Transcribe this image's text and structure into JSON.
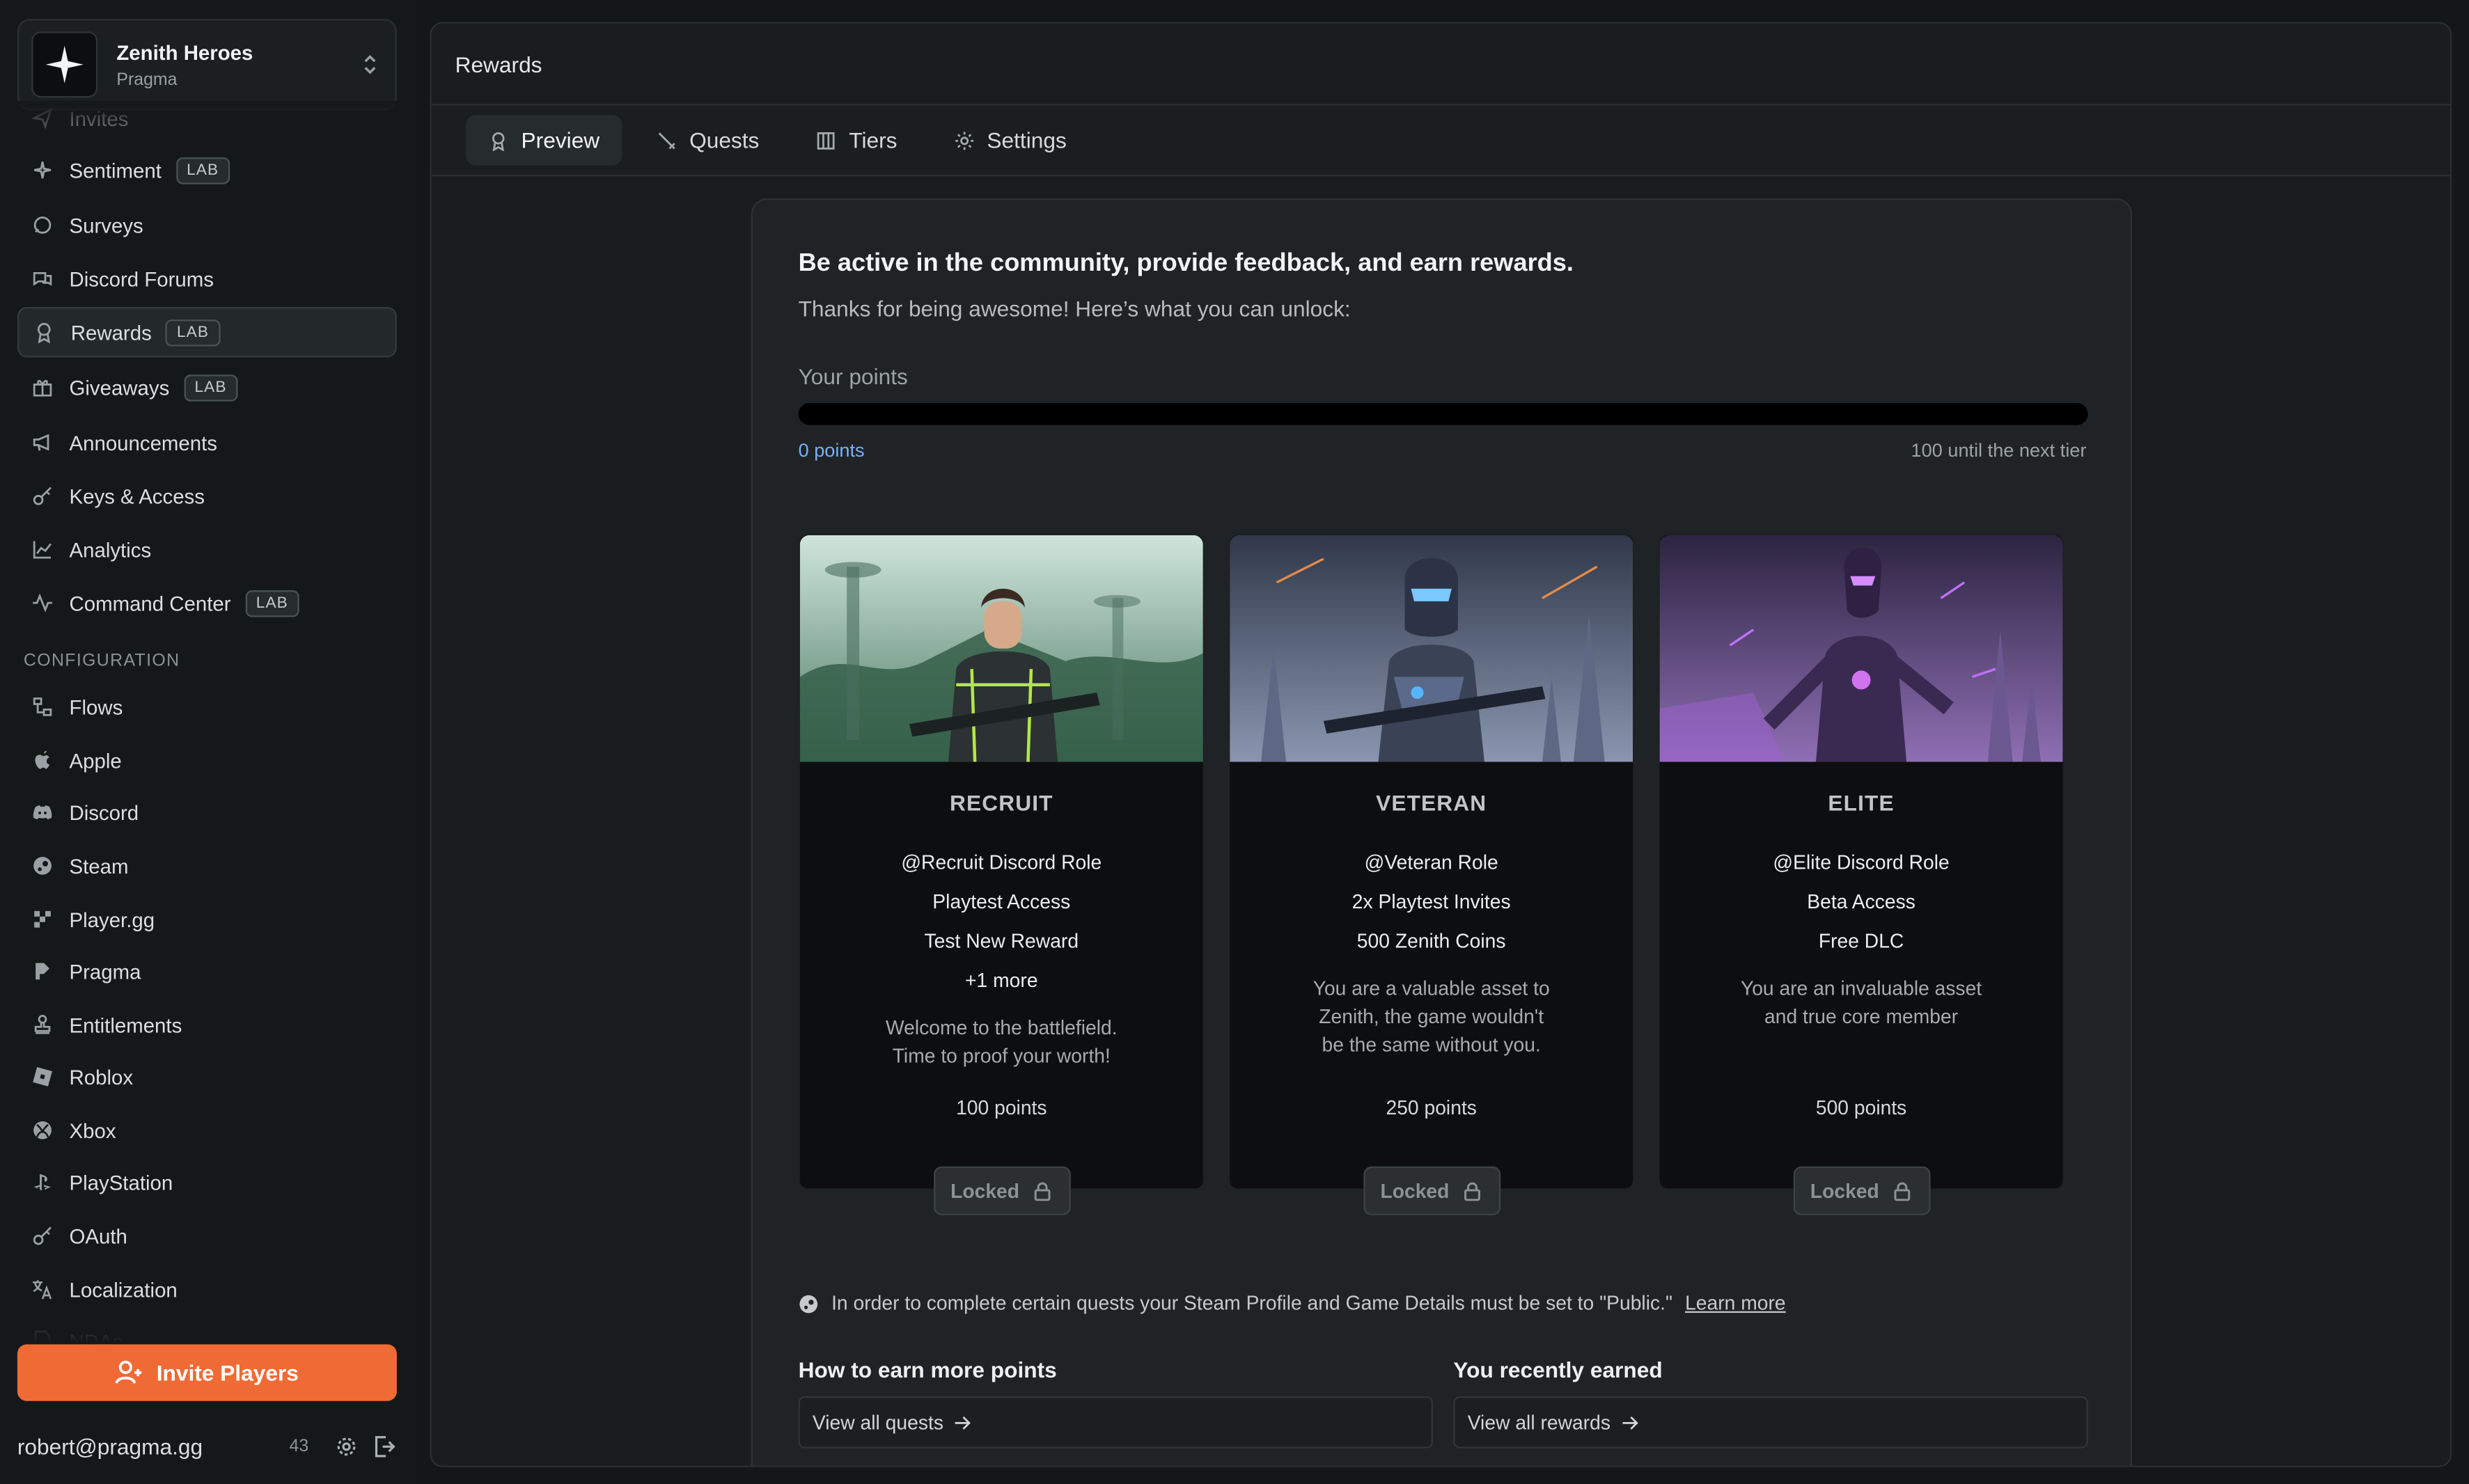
{
  "org": {
    "name": "Zenith Heroes",
    "sub": "Pragma"
  },
  "nav": {
    "items": [
      {
        "label": "Invites",
        "icon": "send-icon",
        "lab": ""
      },
      {
        "label": "Sentiment",
        "icon": "sparkle-icon",
        "lab": "LAB"
      },
      {
        "label": "Surveys",
        "icon": "chat-icon",
        "lab": ""
      },
      {
        "label": "Discord Forums",
        "icon": "forum-icon",
        "lab": ""
      },
      {
        "label": "Rewards",
        "icon": "award-icon",
        "lab": "LAB",
        "active": true
      },
      {
        "label": "Giveaways",
        "icon": "gift-icon",
        "lab": "LAB"
      },
      {
        "label": "Announcements",
        "icon": "megaphone-icon",
        "lab": ""
      },
      {
        "label": "Keys & Access",
        "icon": "key-icon",
        "lab": ""
      },
      {
        "label": "Analytics",
        "icon": "chart-icon",
        "lab": ""
      },
      {
        "label": "Command Center",
        "icon": "pulse-icon",
        "lab": "LAB"
      }
    ],
    "config_label": "CONFIGURATION",
    "config_items": [
      {
        "label": "Flows",
        "icon": "flow-icon"
      },
      {
        "label": "Apple",
        "icon": "apple-icon"
      },
      {
        "label": "Discord",
        "icon": "discord-icon"
      },
      {
        "label": "Steam",
        "icon": "steam-icon"
      },
      {
        "label": "Player.gg",
        "icon": "playergg-icon"
      },
      {
        "label": "Pragma",
        "icon": "pragma-icon"
      },
      {
        "label": "Entitlements",
        "icon": "stamp-icon"
      },
      {
        "label": "Roblox",
        "icon": "roblox-icon"
      },
      {
        "label": "Xbox",
        "icon": "xbox-icon"
      },
      {
        "label": "PlayStation",
        "icon": "playstation-icon"
      },
      {
        "label": "OAuth",
        "icon": "key-icon"
      },
      {
        "label": "Localization",
        "icon": "translate-icon"
      },
      {
        "label": "NDAs",
        "icon": "document-icon"
      }
    ]
  },
  "invite_label": "Invite Players",
  "user": {
    "email": "robert@pragma.gg",
    "count": "43"
  },
  "header": {
    "title": "Rewards"
  },
  "tabs": [
    {
      "label": "Preview",
      "icon": "award-icon",
      "active": true
    },
    {
      "label": "Quests",
      "icon": "sword-icon"
    },
    {
      "label": "Tiers",
      "icon": "columns-icon"
    },
    {
      "label": "Settings",
      "icon": "gear-icon"
    }
  ],
  "panel": {
    "headline": "Be active in the community, provide feedback, and earn rewards.",
    "subline": "Thanks for being awesome! Here’s what you can unlock:",
    "your_points_label": "Your points",
    "progress": 0,
    "points_text": "0 points",
    "next_text": "100 until the next tier",
    "tiers": [
      {
        "name": "RECRUIT",
        "perks": [
          "@Recruit Discord Role",
          "Playtest Access",
          "Test New Reward",
          "+1 more"
        ],
        "desc": "Welcome to the battlefield. Time to proof your worth!",
        "points": "100 points",
        "lock": "Locked"
      },
      {
        "name": "VETERAN",
        "perks": [
          "@Veteran Role",
          "2x Playtest Invites",
          "500 Zenith Coins"
        ],
        "desc": "You are a valuable asset to Zenith, the game wouldn't be the same without you.",
        "points": "250 points",
        "lock": "Locked"
      },
      {
        "name": "ELITE",
        "perks": [
          "@Elite Discord Role",
          "Beta Access",
          "Free DLC"
        ],
        "desc": "You are an invaluable asset and true core member",
        "points": "500 points",
        "lock": "Locked"
      }
    ],
    "notice": "In order to complete certain quests your Steam Profile and Game Details must be set to \"Public.\"",
    "notice_link": "Learn more",
    "earn_title": "How to earn more points",
    "earn_link": "View all quests",
    "recent_title": "You recently earned",
    "recent_link": "View all rewards"
  },
  "colors": {
    "accent": "#f06a35",
    "link": "#79b0ff",
    "bg": "#141718"
  }
}
